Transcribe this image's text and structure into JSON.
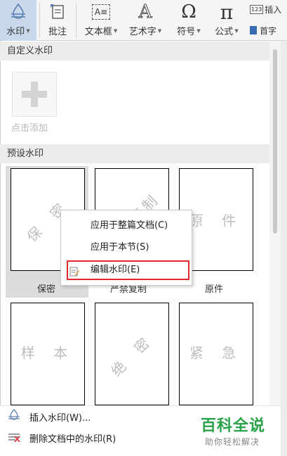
{
  "ribbon": {
    "watermark": "水印",
    "comment": "批注",
    "textbox": "文本框",
    "wordart": "艺术字",
    "symbol": "符号",
    "formula": "公式",
    "insert": "插入",
    "first_letter": "首字",
    "textbox_icon_text": "A≡",
    "wordart_icon_text": "A",
    "symbol_icon_text": "Ω",
    "formula_icon_text": "π",
    "insert_icon_text": "123"
  },
  "panel": {
    "custom_header": "自定义水印",
    "add_label": "点击添加",
    "preset_header": "预设水印",
    "presets": [
      {
        "watermark": "保 密",
        "name": "保密"
      },
      {
        "watermark": "严禁复制",
        "name": "严禁复制"
      },
      {
        "watermark": "原 件",
        "name": "原件"
      },
      {
        "watermark": "样 本",
        "name": ""
      },
      {
        "watermark": "绝 密",
        "name": ""
      },
      {
        "watermark": "紧 急",
        "name": ""
      }
    ]
  },
  "menu": {
    "apply_document": "应用于整篇文档(C)",
    "apply_section": "应用于本节(S)",
    "edit_watermark": "编辑水印(E)"
  },
  "bottom": {
    "insert_watermark": "插入水印(W)...",
    "delete_watermark": "删除文档中的水印(R)"
  },
  "brand": {
    "title": "百科全说",
    "subtitle": "助你轻松解决"
  },
  "colors": {
    "highlight_border": "#e0282d",
    "brand_green": "#2aa24a",
    "active_ribbon": "#c9d8ea"
  }
}
